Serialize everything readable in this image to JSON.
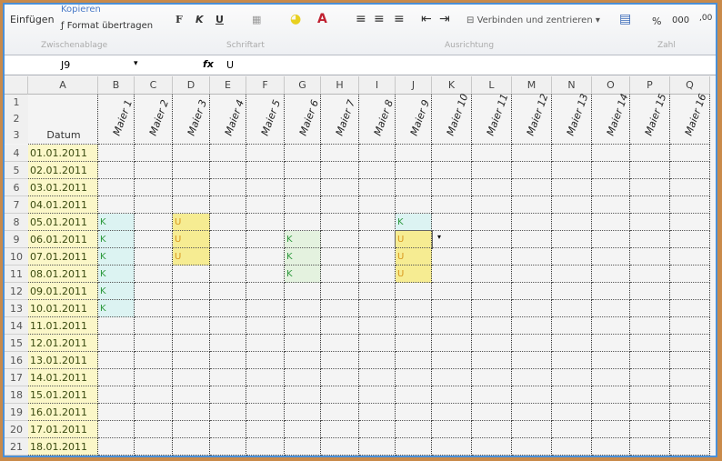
{
  "ribbon": {
    "einfuegen": "Einfügen",
    "kopieren": "Kopieren",
    "format_uebertragen": "Format übertragen",
    "bold": "F",
    "italic": "K",
    "underline": "U",
    "merge_center": "Verbinden und zentrieren",
    "percent": "%",
    "thousands": "000",
    "groups": {
      "clipboard": "Zwischenablage",
      "font": "Schriftart",
      "alignment": "Ausrichtung",
      "number": "Zahl"
    }
  },
  "formula_bar": {
    "name_box": "J9",
    "fx": "fx",
    "value": "U"
  },
  "sheet": {
    "columns": [
      "A",
      "B",
      "C",
      "D",
      "E",
      "F",
      "G",
      "H",
      "I",
      "J",
      "K",
      "L",
      "M",
      "N",
      "O",
      "P",
      "Q"
    ],
    "header_label": "Datum",
    "painters": [
      "Maier 1",
      "Maier 2",
      "Maier 3",
      "Maier 4",
      "Maier 5",
      "Maier 6",
      "Maier 7",
      "Maier 8",
      "Maier 9",
      "Maier 10",
      "Maier 11",
      "Maier 12",
      "Maier 13",
      "Maier 14",
      "Maier 15",
      "Maier 16"
    ],
    "header_rows": [
      "1",
      "2",
      "3"
    ],
    "rows": [
      {
        "num": "4",
        "date": "01.01.2011"
      },
      {
        "num": "5",
        "date": "02.01.2011"
      },
      {
        "num": "6",
        "date": "03.01.2011"
      },
      {
        "num": "7",
        "date": "04.01.2011"
      },
      {
        "num": "8",
        "date": "05.01.2011"
      },
      {
        "num": "9",
        "date": "06.01.2011"
      },
      {
        "num": "10",
        "date": "07.01.2011"
      },
      {
        "num": "11",
        "date": "08.01.2011"
      },
      {
        "num": "12",
        "date": "09.01.2011"
      },
      {
        "num": "13",
        "date": "10.01.2011"
      },
      {
        "num": "14",
        "date": "11.01.2011"
      },
      {
        "num": "15",
        "date": "12.01.2011"
      },
      {
        "num": "16",
        "date": "13.01.2011"
      },
      {
        "num": "17",
        "date": "14.01.2011"
      },
      {
        "num": "18",
        "date": "15.01.2011"
      },
      {
        "num": "19",
        "date": "16.01.2011"
      },
      {
        "num": "20",
        "date": "17.01.2011"
      },
      {
        "num": "21",
        "date": "18.01.2011"
      }
    ],
    "entries": [
      {
        "row": "8",
        "col": "B",
        "value": "K"
      },
      {
        "row": "9",
        "col": "B",
        "value": "K"
      },
      {
        "row": "10",
        "col": "B",
        "value": "K"
      },
      {
        "row": "11",
        "col": "B",
        "value": "K"
      },
      {
        "row": "12",
        "col": "B",
        "value": "K"
      },
      {
        "row": "13",
        "col": "B",
        "value": "K"
      },
      {
        "row": "8",
        "col": "D",
        "value": "U"
      },
      {
        "row": "9",
        "col": "D",
        "value": "U"
      },
      {
        "row": "10",
        "col": "D",
        "value": "U"
      },
      {
        "row": "9",
        "col": "G",
        "value": "K"
      },
      {
        "row": "10",
        "col": "G",
        "value": "K"
      },
      {
        "row": "11",
        "col": "G",
        "value": "K"
      },
      {
        "row": "8",
        "col": "J",
        "value": "K"
      },
      {
        "row": "9",
        "col": "J",
        "value": "U"
      },
      {
        "row": "10",
        "col": "J",
        "value": "U"
      },
      {
        "row": "11",
        "col": "J",
        "value": "U"
      }
    ],
    "colors": {
      "k_bg": "#dcf3f2",
      "k_bg_g": "#e4f2df",
      "k_text": "#2e9a3e",
      "u_bg": "#f6ec92",
      "u_text": "#d8961c"
    }
  }
}
